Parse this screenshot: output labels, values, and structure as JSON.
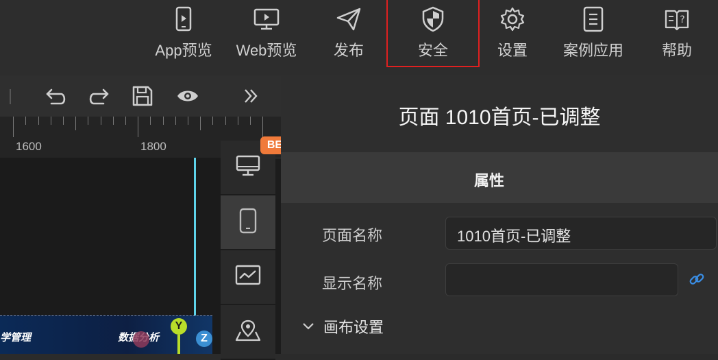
{
  "toolbar": {
    "items": [
      {
        "label": "App预览",
        "icon": "phone-play-icon"
      },
      {
        "label": "Web预览",
        "icon": "monitor-play-icon"
      },
      {
        "label": "发布",
        "icon": "paper-plane-icon"
      },
      {
        "label": "安全",
        "icon": "shield-icon",
        "highlighted": true
      },
      {
        "label": "设置",
        "icon": "gear-icon"
      },
      {
        "label": "案例应用",
        "icon": "document-list-icon"
      },
      {
        "label": "帮助",
        "icon": "book-help-icon"
      }
    ]
  },
  "editor": {
    "tools": [
      "undo-icon",
      "redo-icon",
      "save-icon",
      "eye-icon",
      "double-chevron-right-icon"
    ],
    "ruler": {
      "labels": [
        "1600",
        "1800"
      ]
    },
    "canvas_thumb": {
      "left_text": "学管理",
      "right_text": "数据分析",
      "axis_y": "Y",
      "axis_z": "Z"
    },
    "beta_badge": "BETA",
    "devices": [
      "desktop-icon",
      "mobile-icon",
      "chart-screen-icon",
      "map-pin-icon"
    ]
  },
  "panel": {
    "title": "页面 1010首页-已调整",
    "tab": "属性",
    "fields": [
      {
        "label": "页面名称",
        "value": "1010首页-已调整"
      },
      {
        "label": "显示名称",
        "value": ""
      }
    ],
    "section": "画布设置"
  },
  "colors": {
    "highlight": "#e02020",
    "beta": "#f07a3a",
    "guide": "#5ed3ea",
    "link": "#3a8ee6"
  }
}
